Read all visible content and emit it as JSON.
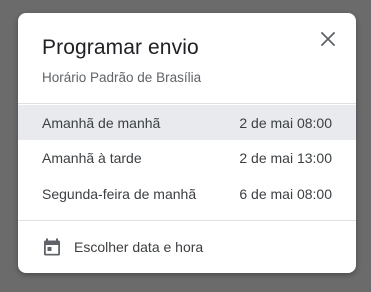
{
  "dialog": {
    "title": "Programar envio",
    "subtitle": "Horário Padrão de Brasília",
    "close_icon": "close-icon",
    "options": [
      {
        "label": "Amanhã de manhã",
        "time": "2 de mai 08:00",
        "selected": true
      },
      {
        "label": "Amanhã à tarde",
        "time": "2 de mai 13:00",
        "selected": false
      },
      {
        "label": "Segunda-feira de manhã",
        "time": "6 de mai 08:00",
        "selected": false
      }
    ],
    "custom": {
      "label": "Escolher data e hora",
      "icon": "calendar-icon"
    }
  },
  "colors": {
    "overlay": "#6b6b6b",
    "dialog_bg": "#ffffff",
    "selected_row": "#e8eaed",
    "title_text": "#202124",
    "secondary_text": "#5f6368"
  }
}
